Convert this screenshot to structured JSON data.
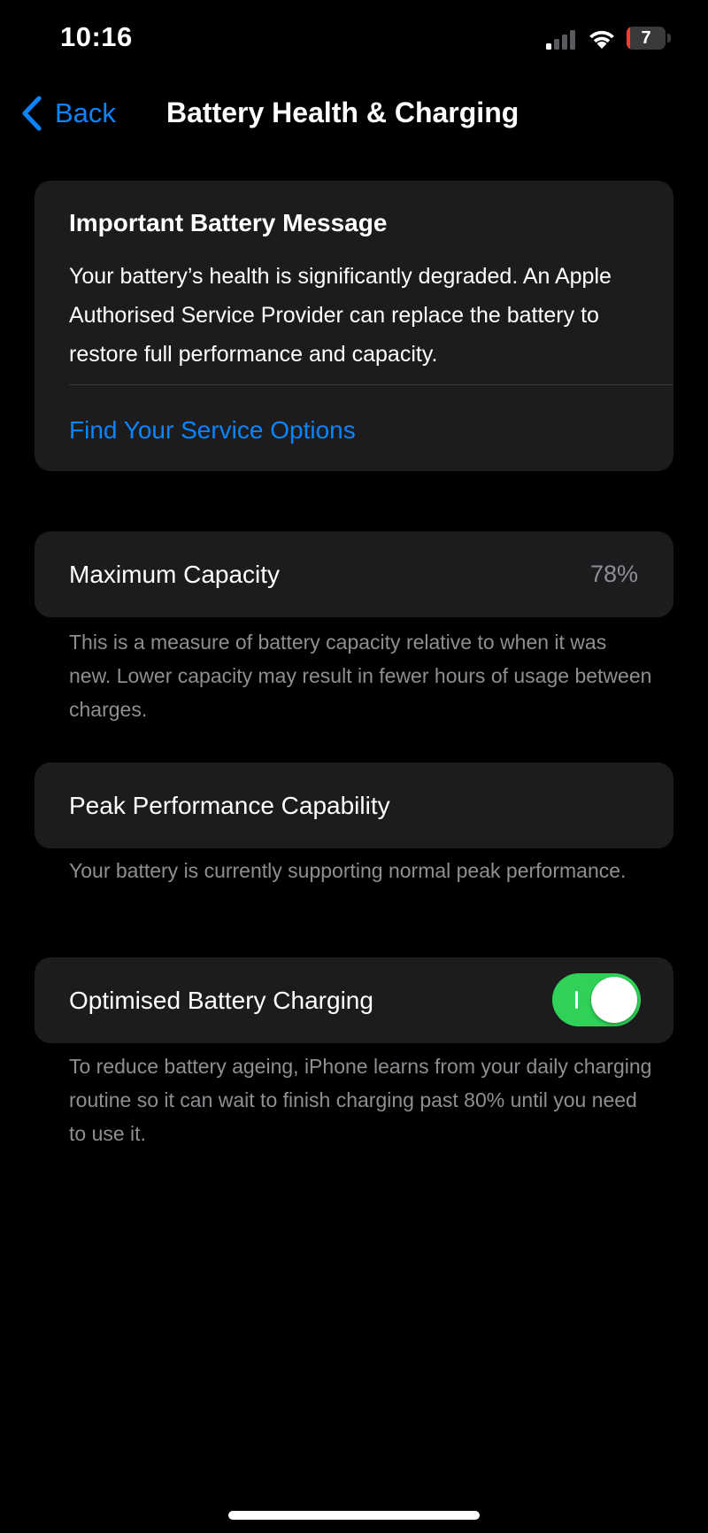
{
  "status_bar": {
    "time": "10:16",
    "battery_level": "7",
    "battery_fraction": 0.07,
    "icons": [
      "cellular-signal-icon",
      "wifi-icon",
      "battery-icon"
    ]
  },
  "nav": {
    "back_label": "Back",
    "title": "Battery Health & Charging"
  },
  "message": {
    "title": "Important Battery Message",
    "body": "Your battery’s health is significantly degraded. An Apple Authorised Service Provider can replace the battery to restore full performance and capacity.",
    "link": "Find Your Service Options"
  },
  "capacity": {
    "label": "Maximum Capacity",
    "value": "78%",
    "note": "This is a measure of battery capacity relative to when it was new. Lower capacity may result in fewer hours of usage between charges."
  },
  "performance": {
    "label": "Peak Performance Capability",
    "note": "Your battery is currently supporting normal peak performance."
  },
  "charging": {
    "label": "Optimised Battery Charging",
    "enabled": true,
    "note": "To reduce battery ageing, iPhone learns from your daily charging routine so it can wait to finish charging past 80% until you need to use it."
  },
  "colors": {
    "accent": "#0a84ff",
    "toggle_on": "#30d158",
    "battery_low": "#ff3b30",
    "card_bg": "#1c1c1e",
    "secondary_text": "#8e8e93"
  }
}
